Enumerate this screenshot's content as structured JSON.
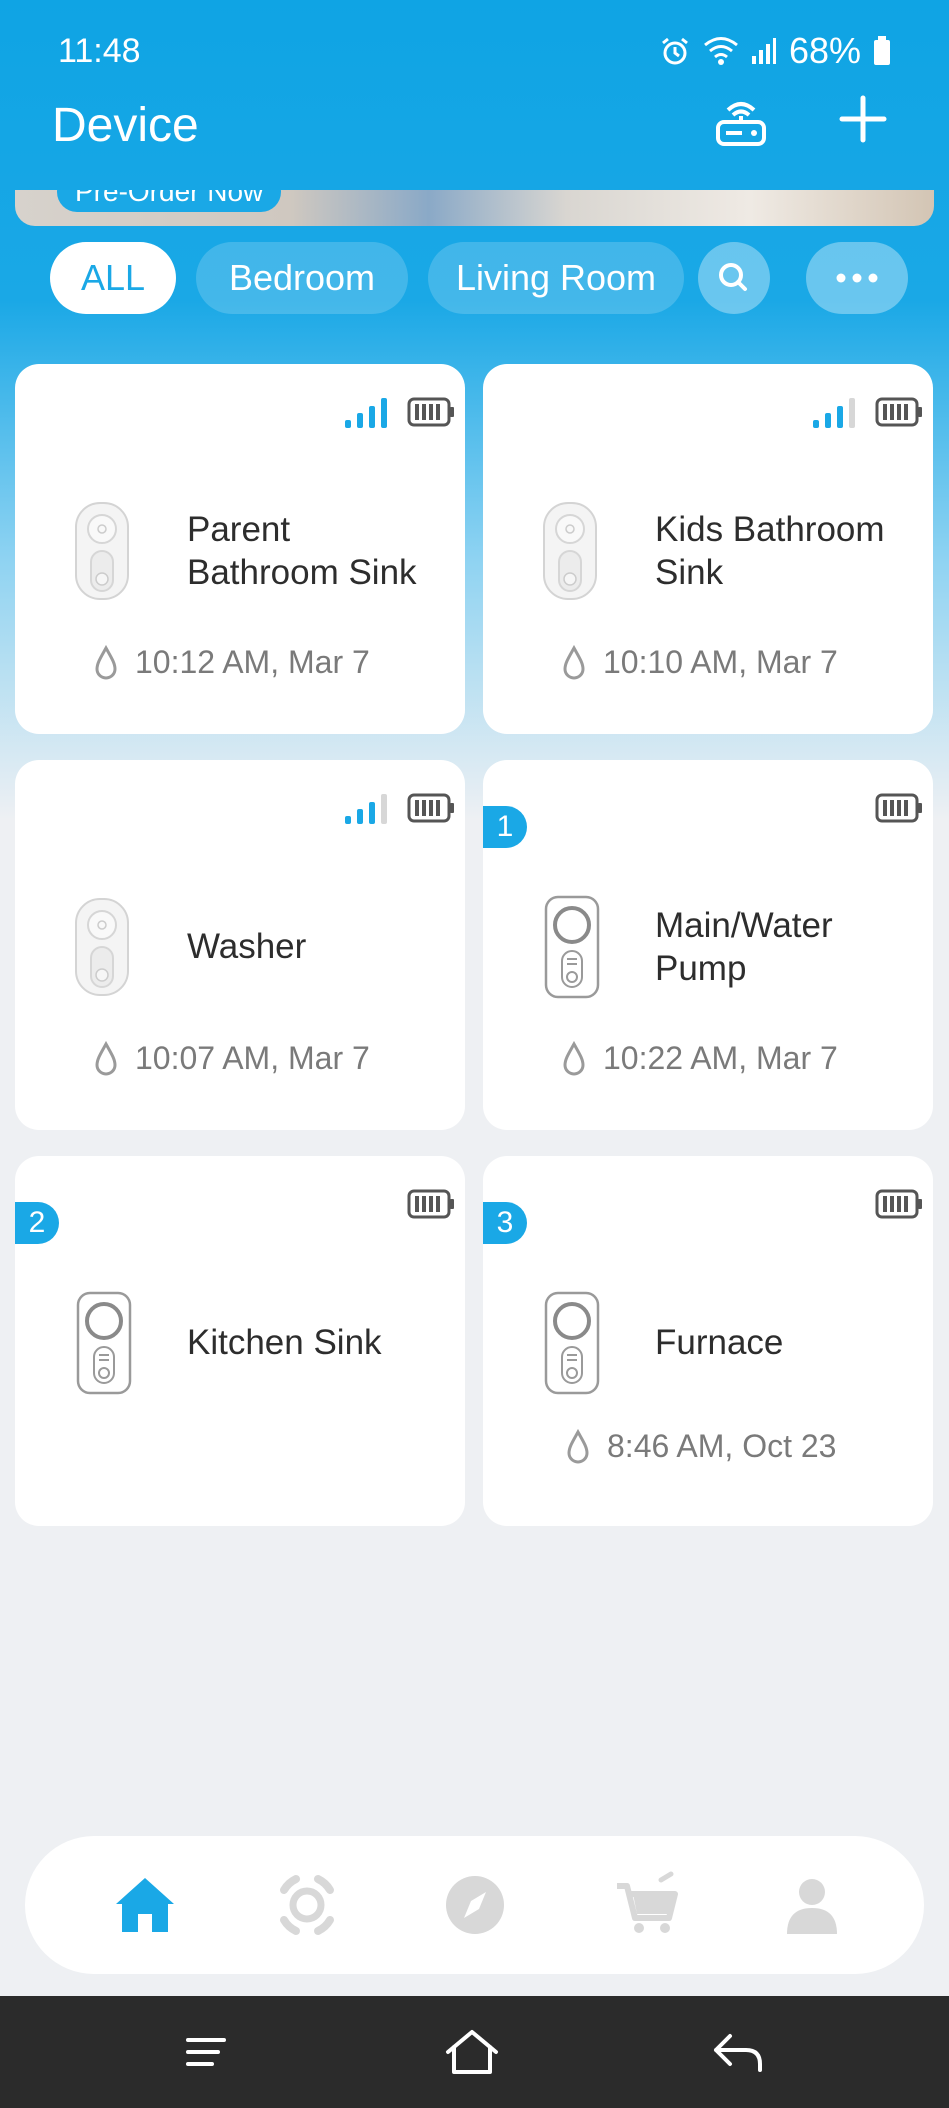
{
  "status_bar": {
    "time": "11:48",
    "battery_percent": "68%"
  },
  "header": {
    "title": "Device"
  },
  "banner": {
    "label": "Pre-Order Now"
  },
  "filters": {
    "chips": [
      "ALL",
      "Bedroom",
      "Living Room"
    ],
    "active": "ALL"
  },
  "devices": [
    {
      "name": "Parent Bathroom Sink",
      "time": "10:12 AM, Mar 7",
      "signal_bars": 4,
      "badge": ""
    },
    {
      "name": "Kids Bathroom Sink",
      "time": "10:10 AM, Mar 7",
      "signal_bars": 3,
      "badge": ""
    },
    {
      "name": "Washer",
      "time": "10:07 AM, Mar 7",
      "signal_bars": 3,
      "badge": ""
    },
    {
      "name": "Main/Water Pump",
      "time": "10:22 AM, Mar 7",
      "signal_bars": 0,
      "badge": "1"
    },
    {
      "name": "Kitchen Sink",
      "time": "",
      "signal_bars": 0,
      "badge": "2"
    },
    {
      "name": "Furnace",
      "time": "8:46 AM, Oct 23",
      "signal_bars": 0,
      "badge": "3"
    }
  ],
  "bottom_nav": {
    "items": [
      "home-icon",
      "scene-icon",
      "discover-icon",
      "shop-icon",
      "profile-icon"
    ],
    "active": "home-icon"
  },
  "colors": {
    "accent": "#1aa8e6",
    "inactive_icon": "#d8d8d8"
  }
}
